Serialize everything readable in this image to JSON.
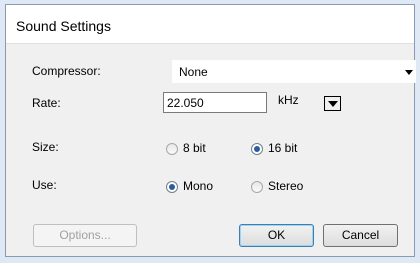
{
  "window": {
    "title": "Sound Settings"
  },
  "form": {
    "compressor": {
      "label": "Compressor:",
      "value": "None"
    },
    "rate": {
      "label": "Rate:",
      "value": "22.050",
      "unit": "kHz"
    },
    "size": {
      "label": "Size:",
      "options": [
        "8 bit",
        "16 bit"
      ],
      "selected": "16 bit"
    },
    "use": {
      "label": "Use:",
      "options": [
        "Mono",
        "Stereo"
      ],
      "selected": "Mono"
    }
  },
  "buttons": {
    "options": "Options...",
    "ok": "OK",
    "cancel": "Cancel"
  }
}
